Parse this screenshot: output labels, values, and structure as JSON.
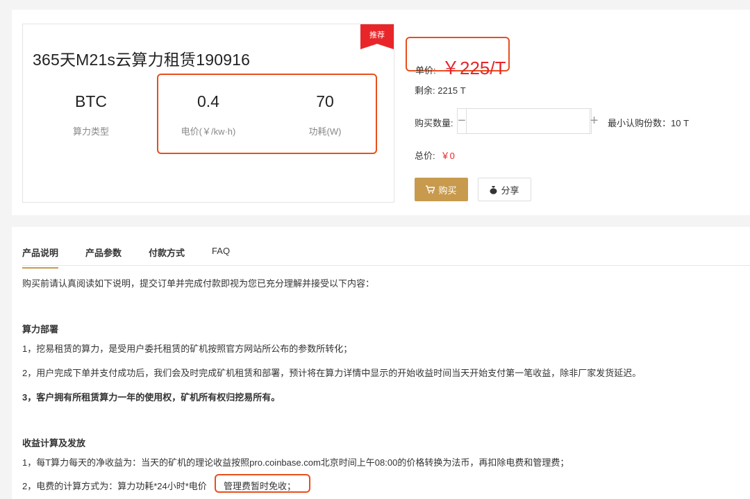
{
  "product": {
    "badge": "推荐",
    "title": "365天M21s云算力租赁190916",
    "stats": [
      {
        "value": "BTC",
        "label": "算力类型"
      },
      {
        "value": "0.4",
        "label": "电价(￥/kw·h)"
      },
      {
        "value": "70",
        "label": "功耗(W)"
      }
    ]
  },
  "order": {
    "price_label": "单价:",
    "price_value": "￥225/T",
    "remaining": "剩余: 2215 T",
    "qty_label": "购买数量:",
    "qty_minus": "−",
    "qty_plus": "+",
    "qty_value": "",
    "min_buy": "最小认购份数：10 T",
    "total_label": "总价:",
    "total_value": "￥0",
    "buy_label": "购买",
    "share_label": "分享"
  },
  "tabs": [
    {
      "label": "产品说明"
    },
    {
      "label": "产品参数"
    },
    {
      "label": "付款方式"
    },
    {
      "label": "FAQ"
    }
  ],
  "description": {
    "intro": "购买前请认真阅读如下说明，提交订单并完成付款即视为您已充分理解并接受以下内容：",
    "section1_title": "算力部署",
    "section1_items": [
      "1，挖易租赁的算力，是受用户委托租赁的矿机按照官方网站所公布的参数所转化；",
      "2，用户完成下单并支付成功后，我们会及时完成矿机租赁和部署，预计将在算力详情中显示的开始收益时间当天开始支付第一笔收益，除非厂家发货延迟。",
      "3，客户拥有所租赁算力一年的使用权，矿机所有权归挖易所有。"
    ],
    "section2_title": "收益计算及发放",
    "section2_items": [
      "1，每T算力每天的净收益为：当天的矿机的理论收益按照pro.coinbase.com北京时间上午08:00的价格转换为法币，再扣除电费和管理费；",
      "2，电费的计算方式为：算力功耗*24小时*电价",
      "管理费暂时免收；"
    ]
  },
  "colors": {
    "accent_red": "#e8262a",
    "highlight_orange": "#e84e1b",
    "gold": "#c79a4d"
  }
}
